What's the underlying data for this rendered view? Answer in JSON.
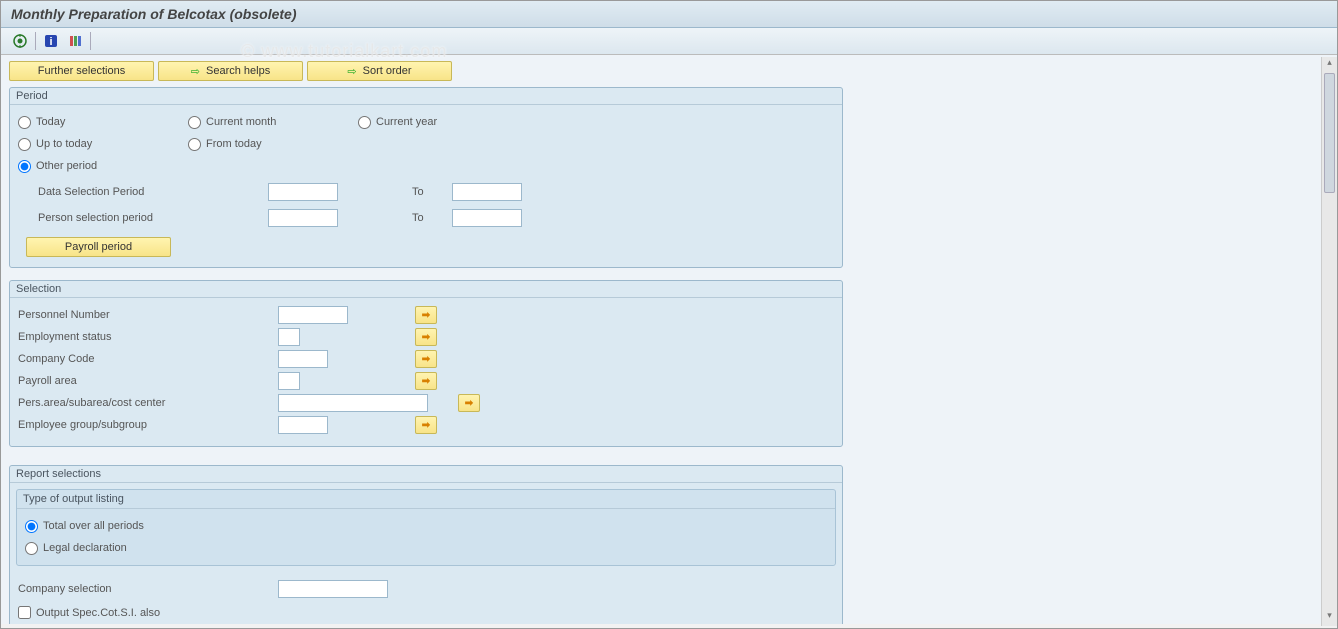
{
  "title": "Monthly Preparation of Belcotax (obsolete)",
  "watermark": "© www.tutorialkart.com",
  "topButtons": {
    "further": "Further selections",
    "search": "Search helps",
    "sort": "Sort order"
  },
  "period": {
    "legend": "Period",
    "today": "Today",
    "currentMonth": "Current month",
    "currentYear": "Current year",
    "upToToday": "Up to today",
    "fromToday": "From today",
    "otherPeriod": "Other period",
    "dataSelection": "Data Selection Period",
    "personSelection": "Person selection period",
    "to": "To",
    "payrollPeriod": "Payroll period"
  },
  "selection": {
    "legend": "Selection",
    "rows": [
      {
        "label": "Personnel Number"
      },
      {
        "label": "Employment status"
      },
      {
        "label": "Company Code"
      },
      {
        "label": "Payroll area"
      },
      {
        "label": "Pers.area/subarea/cost center"
      },
      {
        "label": "Employee group/subgroup"
      }
    ]
  },
  "report": {
    "legend": "Report selections",
    "outputType": {
      "legend": "Type of output listing",
      "total": "Total over all periods",
      "legal": "Legal declaration"
    },
    "companySelection": "Company selection",
    "outputSpec": "Output Spec.Cot.S.I. also"
  }
}
